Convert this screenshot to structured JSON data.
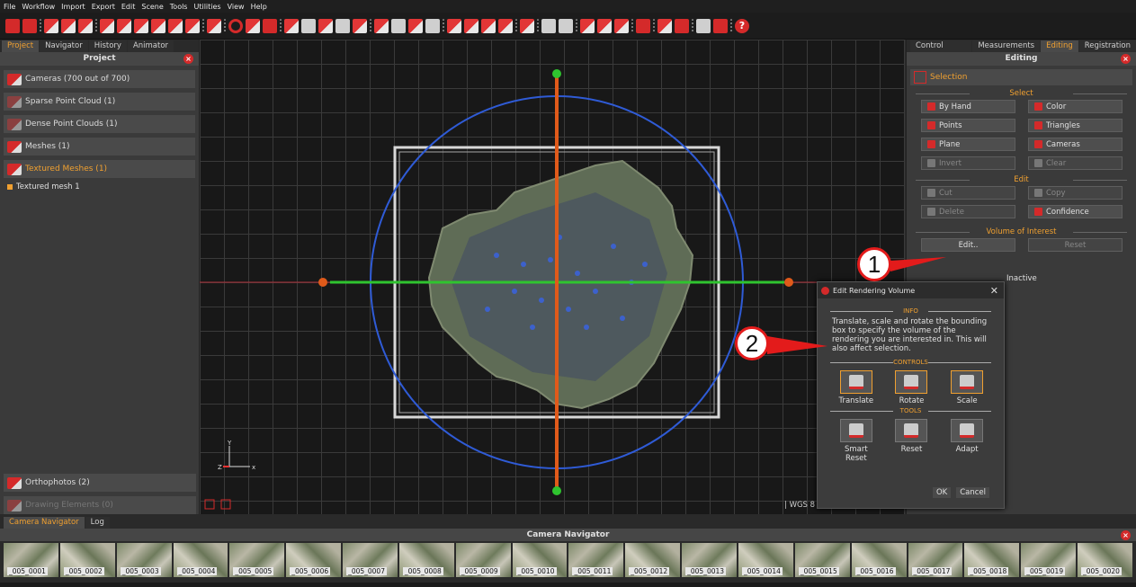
{
  "menu": [
    "File",
    "Workflow",
    "Import",
    "Export",
    "Edit",
    "Scene",
    "Tools",
    "Utilities",
    "View",
    "Help"
  ],
  "left_panel": {
    "tabs": [
      "Project",
      "Navigator",
      "History",
      "Animator"
    ],
    "title": "Project",
    "groups": [
      "Cameras (700 out of 700)",
      "Sparse Point Cloud (1)",
      "Dense Point Clouds (1)",
      "Meshes (1)",
      "Textured Meshes (1)"
    ],
    "textured_item": "Textured mesh 1",
    "bottom_groups": [
      "Orthophotos (2)",
      "Drawing Elements (0)"
    ]
  },
  "right_panel": {
    "tabs": [
      "Control points",
      "Measurements",
      "Editing",
      "Registration"
    ],
    "title": "Editing",
    "selection_label": "Selection",
    "select_heading": "Select",
    "select_buttons": [
      "By Hand",
      "Color",
      "Points",
      "Triangles",
      "Plane",
      "Cameras",
      "Invert",
      "Clear"
    ],
    "edit_heading": "Edit",
    "edit_buttons": [
      "Cut",
      "Copy",
      "Delete",
      "Confidence"
    ],
    "voi_heading": "Volume of Interest",
    "voi_edit": "Edit..",
    "voi_reset": "Reset",
    "status": "Inactive"
  },
  "viewport": {
    "status": "| WGS 8",
    "axis_y": "Y",
    "axis_x": "x",
    "axis_z": "Z"
  },
  "dialog": {
    "title": "Edit Rendering Volume",
    "info_heading": "INFO",
    "info_text": "Translate, scale and rotate the bounding box to specify the volume of the rendering you are interested in. This will also affect selection.",
    "controls_heading": "CONTROLS",
    "controls": [
      "Translate",
      "Rotate",
      "Scale"
    ],
    "tools_heading": "TOOLS",
    "tools": [
      "Smart Reset",
      "Reset",
      "Adapt"
    ],
    "ok": "OK",
    "cancel": "Cancel"
  },
  "callouts": [
    "1",
    "2"
  ],
  "camera_nav": {
    "tabs": [
      "Camera Navigator",
      "Log"
    ],
    "title": "Camera Navigator",
    "thumbs": [
      "_005_0001",
      "_005_0002",
      "_005_0003",
      "_005_0004",
      "_005_0005",
      "_005_0006",
      "_005_0007",
      "_005_0008",
      "_005_0009",
      "_005_0010",
      "_005_0011",
      "_005_0012",
      "_005_0013",
      "_005_0014",
      "_005_0015",
      "_005_0016",
      "_005_0017",
      "_005_0018",
      "_005_0019",
      "_005_0020"
    ]
  },
  "colors": {
    "accent": "#f0a030",
    "brand_red": "#d42a2a",
    "gizmo_blue": "#2f5bd6",
    "gizmo_orange": "#e05a1a",
    "gizmo_green": "#2fc42f"
  }
}
